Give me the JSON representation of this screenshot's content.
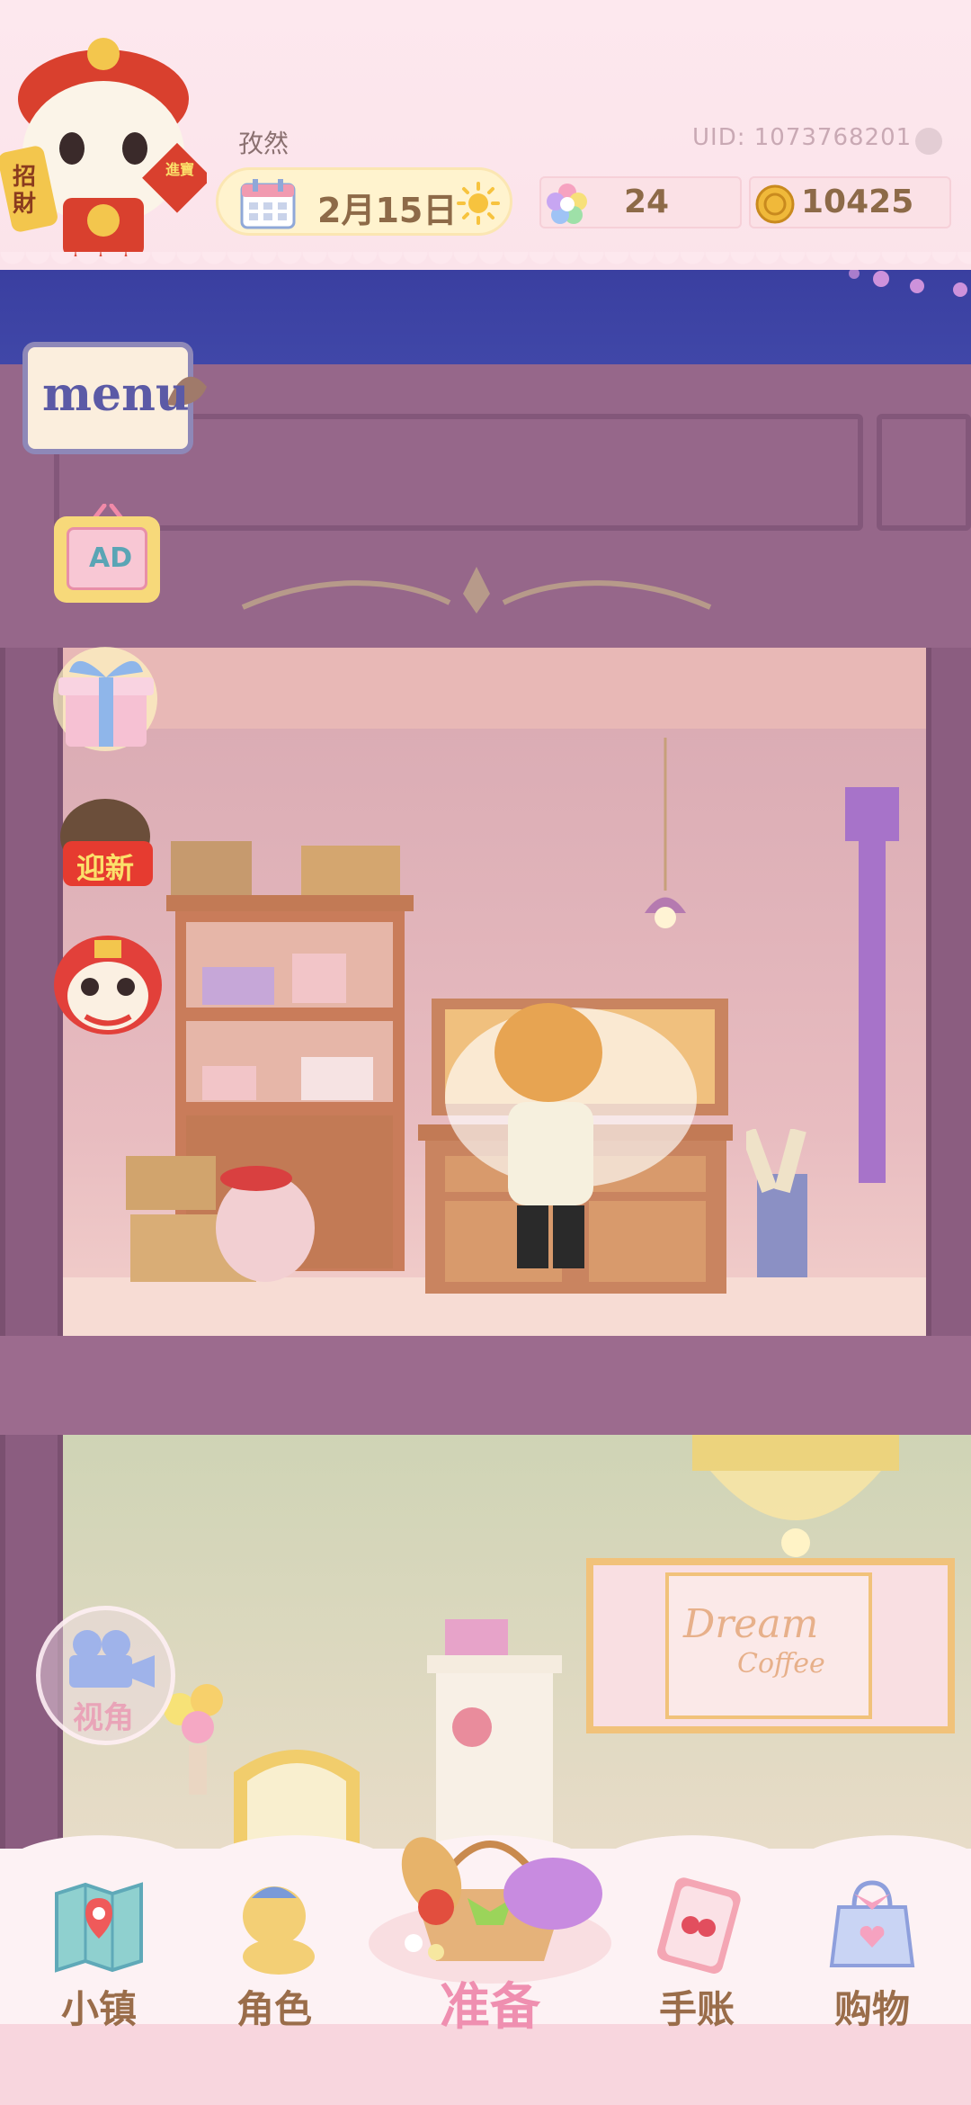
{
  "header": {
    "username": "孜然",
    "uid": "UID: 1073768201",
    "date": "2月15日",
    "weather_icon": "sun-icon",
    "gems": "24",
    "coins": "10425",
    "avatar_badge_left": "招財",
    "avatar_badge_right": "進寶"
  },
  "side_buttons": {
    "menu_label": "menu",
    "ad_label": "AD",
    "cat_badge": "迎新",
    "camera_label": "视角"
  },
  "scene": {
    "sign_line1": "Dream",
    "sign_line2": "Coffee"
  },
  "nav": {
    "items": [
      {
        "label": "小镇",
        "icon": "map-icon"
      },
      {
        "label": "角色",
        "icon": "character-icon"
      },
      {
        "label": "准备",
        "icon": "basket-icon"
      },
      {
        "label": "手账",
        "icon": "journal-icon"
      },
      {
        "label": "购物",
        "icon": "shopping-bag-icon"
      }
    ]
  },
  "colors": {
    "header_bg": "#fde8ee",
    "night_sky": "#3a3fa0",
    "building": "#9a6a8c",
    "nav_label": "#9a6d4a",
    "nav_active": "#ef8fb0"
  }
}
